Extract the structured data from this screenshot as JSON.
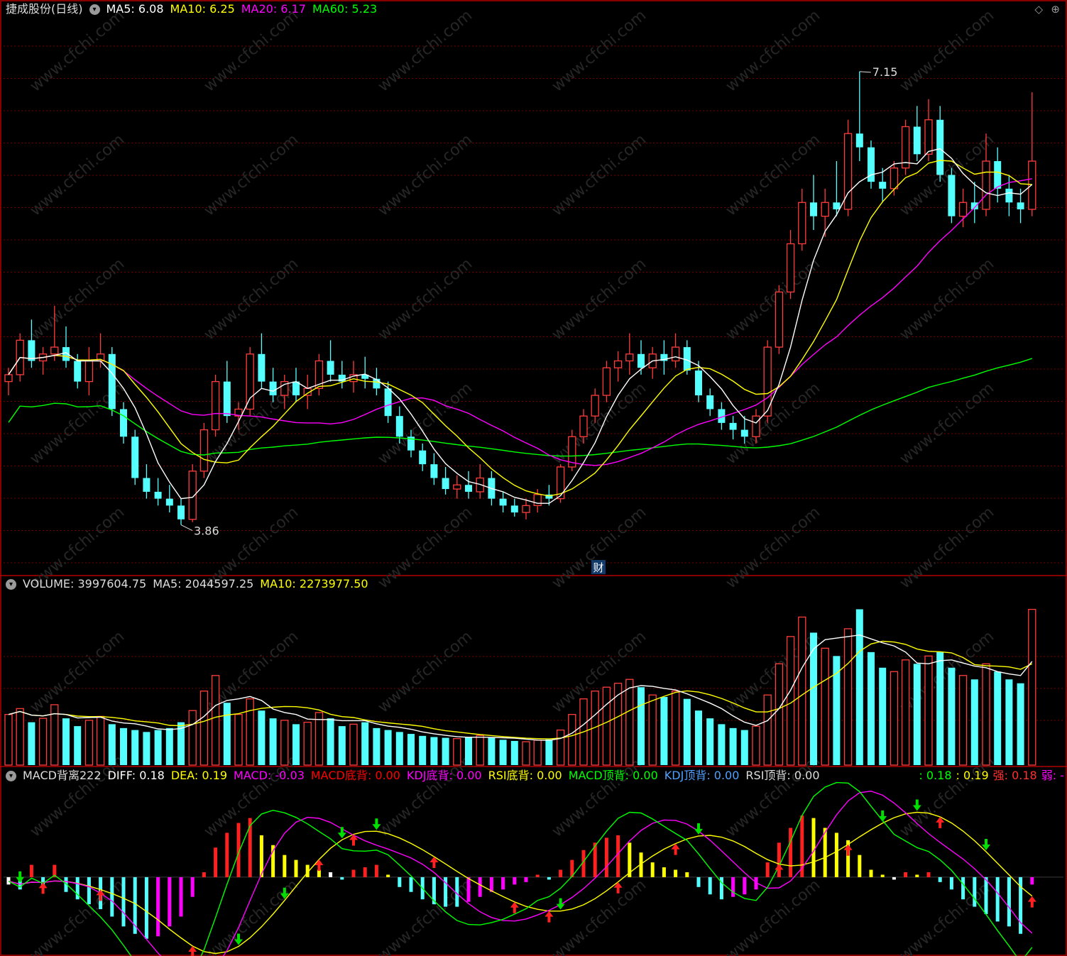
{
  "price_panel": {
    "stock_name": "捷成股份(日线)",
    "ma_readouts": [
      {
        "label": "MA5: 6.08",
        "color": "#ffffff"
      },
      {
        "label": "MA10: 6.25",
        "color": "#ffff00"
      },
      {
        "label": "MA20: 6.17",
        "color": "#ff00ff"
      },
      {
        "label": "MA60: 5.23",
        "color": "#00ff00"
      }
    ],
    "high_annotation": "7.15",
    "low_annotation": "3.86",
    "finance_marker": "财",
    "colors": {
      "up": "#ff3c3c",
      "down": "#54ffff",
      "ma5": "#ffffff",
      "ma10": "#ffff00",
      "ma20": "#ff00ff",
      "ma60": "#00ff00",
      "grid": "#7a0000",
      "divider": "#b40000"
    },
    "controls": [
      "◇",
      "⊕"
    ]
  },
  "volume_panel": {
    "readouts": [
      {
        "label": "VOLUME: 3997604.75",
        "color": "#dddddd"
      },
      {
        "label": "MA5: 2044597.25",
        "color": "#dddddd"
      },
      {
        "label": "MA10: 2273977.50",
        "color": "#ffff00"
      }
    ]
  },
  "macd_panel": {
    "readouts": [
      {
        "label": "MACD背离222",
        "color": "#dddddd"
      },
      {
        "label": "DIFF: 0.18",
        "color": "#ffffff"
      },
      {
        "label": "DEA: 0.19",
        "color": "#ffff00"
      },
      {
        "label": "MACD: -0.03",
        "color": "#ff00ff"
      },
      {
        "label": "MACD底背: 0.00",
        "color": "#ff0000"
      },
      {
        "label": "KDJ底背: 0.00",
        "color": "#ff00ff"
      },
      {
        "label": "RSI底背: 0.00",
        "color": "#ffff00"
      },
      {
        "label": "MACD顶背: 0.00",
        "color": "#00ff00"
      },
      {
        "label": "KDJ顶背: 0.00",
        "color": "#4fa0ff"
      },
      {
        "label": "RSI顶背: 0.00",
        "color": "#dddddd"
      }
    ],
    "right_readouts": [
      {
        "label": ": 0.18",
        "color": "#00ff00"
      },
      {
        "label": ": 0.19",
        "color": "#ffff00"
      },
      {
        "label": "强: 0.18",
        "color": "#ff3030"
      },
      {
        "label": "弱: -",
        "color": "#ff00ff"
      }
    ]
  },
  "watermark": "www.cfchi.com",
  "chart_data": [
    {
      "type": "candlestick",
      "title": "捷成股份(日线)",
      "price_range": [
        3.6,
        7.35
      ],
      "bars": 90,
      "ohlc": [
        [
          4.9,
          5.0,
          4.8,
          4.95
        ],
        [
          4.95,
          5.25,
          4.9,
          5.2
        ],
        [
          5.2,
          5.35,
          5.0,
          5.05
        ],
        [
          5.05,
          5.15,
          4.95,
          5.1
        ],
        [
          5.1,
          5.45,
          5.05,
          5.15
        ],
        [
          5.15,
          5.3,
          5.0,
          5.05
        ],
        [
          5.05,
          5.1,
          4.85,
          4.9
        ],
        [
          4.9,
          5.15,
          4.8,
          5.05
        ],
        [
          5.05,
          5.25,
          5.0,
          5.1
        ],
        [
          5.1,
          5.15,
          4.65,
          4.7
        ],
        [
          4.7,
          4.75,
          4.45,
          4.5
        ],
        [
          4.5,
          4.55,
          4.15,
          4.2
        ],
        [
          4.2,
          4.3,
          4.05,
          4.1
        ],
        [
          4.1,
          4.2,
          4.0,
          4.05
        ],
        [
          4.05,
          4.15,
          3.95,
          4.0
        ],
        [
          4.0,
          4.05,
          3.86,
          3.9
        ],
        [
          3.9,
          4.3,
          3.88,
          4.25
        ],
        [
          4.25,
          4.6,
          4.2,
          4.55
        ],
        [
          4.55,
          4.95,
          4.5,
          4.9
        ],
        [
          4.9,
          5.05,
          4.6,
          4.65
        ],
        [
          4.65,
          4.75,
          4.55,
          4.7
        ],
        [
          4.7,
          5.15,
          4.65,
          5.1
        ],
        [
          5.1,
          5.25,
          4.85,
          4.9
        ],
        [
          4.9,
          5.0,
          4.75,
          4.8
        ],
        [
          4.8,
          4.95,
          4.7,
          4.9
        ],
        [
          4.9,
          5.0,
          4.75,
          4.8
        ],
        [
          4.8,
          4.95,
          4.7,
          4.85
        ],
        [
          4.85,
          5.1,
          4.8,
          5.05
        ],
        [
          5.05,
          5.2,
          4.9,
          4.95
        ],
        [
          4.95,
          5.05,
          4.85,
          4.9
        ],
        [
          4.9,
          5.05,
          4.82,
          4.95
        ],
        [
          4.95,
          5.08,
          4.85,
          4.92
        ],
        [
          4.92,
          5.0,
          4.8,
          4.85
        ],
        [
          4.85,
          4.9,
          4.6,
          4.65
        ],
        [
          4.65,
          4.72,
          4.45,
          4.5
        ],
        [
          4.5,
          4.55,
          4.35,
          4.4
        ],
        [
          4.4,
          4.45,
          4.25,
          4.3
        ],
        [
          4.3,
          4.38,
          4.15,
          4.2
        ],
        [
          4.2,
          4.28,
          4.08,
          4.12
        ],
        [
          4.12,
          4.22,
          4.05,
          4.15
        ],
        [
          4.15,
          4.25,
          4.05,
          4.1
        ],
        [
          4.1,
          4.3,
          4.05,
          4.2
        ],
        [
          4.2,
          4.25,
          4.0,
          4.05
        ],
        [
          4.05,
          4.1,
          3.95,
          4.0
        ],
        [
          4.0,
          4.05,
          3.92,
          3.95
        ],
        [
          3.95,
          4.05,
          3.9,
          4.0
        ],
        [
          4.0,
          4.12,
          3.95,
          4.08
        ],
        [
          4.08,
          4.15,
          4.0,
          4.05
        ],
        [
          4.05,
          4.3,
          4.02,
          4.28
        ],
        [
          4.28,
          4.55,
          4.25,
          4.5
        ],
        [
          4.5,
          4.7,
          4.45,
          4.65
        ],
        [
          4.65,
          4.85,
          4.6,
          4.8
        ],
        [
          4.8,
          5.05,
          4.75,
          5.0
        ],
        [
          5.0,
          5.12,
          4.9,
          5.05
        ],
        [
          5.05,
          5.25,
          4.95,
          5.1
        ],
        [
          5.1,
          5.2,
          4.95,
          5.0
        ],
        [
          5.0,
          5.15,
          4.92,
          5.1
        ],
        [
          5.1,
          5.2,
          4.95,
          5.05
        ],
        [
          5.05,
          5.25,
          5.0,
          5.15
        ],
        [
          5.15,
          5.2,
          4.95,
          4.98
        ],
        [
          4.98,
          5.05,
          4.75,
          4.8
        ],
        [
          4.8,
          4.85,
          4.65,
          4.7
        ],
        [
          4.7,
          4.75,
          4.55,
          4.6
        ],
        [
          4.6,
          4.65,
          4.48,
          4.55
        ],
        [
          4.55,
          4.65,
          4.45,
          4.5
        ],
        [
          4.5,
          4.7,
          4.45,
          4.65
        ],
        [
          4.65,
          5.2,
          4.6,
          5.15
        ],
        [
          5.15,
          5.6,
          5.1,
          5.55
        ],
        [
          5.55,
          6.0,
          5.5,
          5.9
        ],
        [
          5.9,
          6.3,
          5.85,
          6.2
        ],
        [
          6.2,
          6.4,
          6.0,
          6.1
        ],
        [
          6.1,
          6.3,
          5.95,
          6.2
        ],
        [
          6.2,
          6.5,
          6.1,
          6.15
        ],
        [
          6.15,
          6.8,
          6.1,
          6.7
        ],
        [
          6.7,
          7.15,
          6.5,
          6.6
        ],
        [
          6.6,
          6.65,
          6.3,
          6.35
        ],
        [
          6.35,
          6.45,
          6.2,
          6.3
        ],
        [
          6.3,
          6.5,
          6.25,
          6.45
        ],
        [
          6.45,
          6.8,
          6.4,
          6.75
        ],
        [
          6.75,
          6.9,
          6.5,
          6.55
        ],
        [
          6.55,
          6.95,
          6.5,
          6.8
        ],
        [
          6.8,
          6.9,
          6.35,
          6.4
        ],
        [
          6.4,
          6.45,
          6.05,
          6.1
        ],
        [
          6.1,
          6.3,
          6.02,
          6.2
        ],
        [
          6.2,
          6.35,
          6.05,
          6.15
        ],
        [
          6.15,
          6.7,
          6.1,
          6.5
        ],
        [
          6.5,
          6.6,
          6.2,
          6.3
        ],
        [
          6.3,
          6.4,
          6.1,
          6.2
        ],
        [
          6.2,
          6.3,
          6.05,
          6.15
        ],
        [
          6.15,
          7.0,
          6.1,
          6.5
        ]
      ]
    },
    {
      "type": "bar",
      "title": "VOLUME",
      "ylim": [
        0,
        4300000
      ],
      "values": [
        1300000,
        1450000,
        1100000,
        1200000,
        1550000,
        1200000,
        1000000,
        1150000,
        1250000,
        1050000,
        950000,
        900000,
        850000,
        900000,
        950000,
        1100000,
        1400000,
        1900000,
        2300000,
        1600000,
        1300000,
        1700000,
        1400000,
        1200000,
        1150000,
        1050000,
        1100000,
        1350000,
        1200000,
        1000000,
        1050000,
        1100000,
        950000,
        900000,
        850000,
        800000,
        750000,
        720000,
        700000,
        680000,
        720000,
        760000,
        700000,
        650000,
        620000,
        600000,
        640000,
        660000,
        900000,
        1300000,
        1700000,
        1900000,
        2000000,
        2100000,
        2200000,
        2000000,
        1800000,
        1750000,
        1900000,
        1700000,
        1400000,
        1200000,
        1050000,
        950000,
        900000,
        1000000,
        1800000,
        2600000,
        3300000,
        3800000,
        3400000,
        3000000,
        2800000,
        3500000,
        4000000,
        2900000,
        2500000,
        2400000,
        2700000,
        2600000,
        2800000,
        2900000,
        2500000,
        2300000,
        2200000,
        2600000,
        2400000,
        2200000,
        2100000,
        3997604.75
      ]
    },
    {
      "type": "bar",
      "title": "MACD背离222",
      "ylim": [
        -0.32,
        0.38
      ],
      "values": [
        -0.03,
        -0.05,
        0.05,
        -0.04,
        0.05,
        -0.06,
        -0.09,
        -0.11,
        -0.13,
        -0.16,
        -0.2,
        -0.23,
        -0.25,
        -0.24,
        -0.2,
        -0.16,
        -0.08,
        0.02,
        0.12,
        0.18,
        0.22,
        0.24,
        0.17,
        0.13,
        0.09,
        0.07,
        0.05,
        0.03,
        0.02,
        -0.01,
        0.03,
        0.04,
        0.05,
        0.01,
        -0.04,
        -0.06,
        -0.09,
        -0.11,
        -0.12,
        -0.12,
        -0.1,
        -0.08,
        -0.06,
        -0.05,
        -0.03,
        -0.02,
        0.01,
        -0.01,
        0.03,
        0.07,
        0.11,
        0.14,
        0.16,
        0.17,
        0.14,
        0.1,
        0.06,
        0.04,
        0.03,
        0.02,
        -0.04,
        -0.07,
        -0.09,
        -0.08,
        -0.07,
        -0.05,
        0.06,
        0.14,
        0.2,
        0.25,
        0.24,
        0.2,
        0.18,
        0.15,
        0.09,
        0.03,
        0.01,
        -0.01,
        0.02,
        0.01,
        0.02,
        -0.02,
        -0.05,
        -0.09,
        -0.12,
        -0.15,
        -0.18,
        -0.2,
        -0.23,
        -0.03
      ]
    }
  ]
}
